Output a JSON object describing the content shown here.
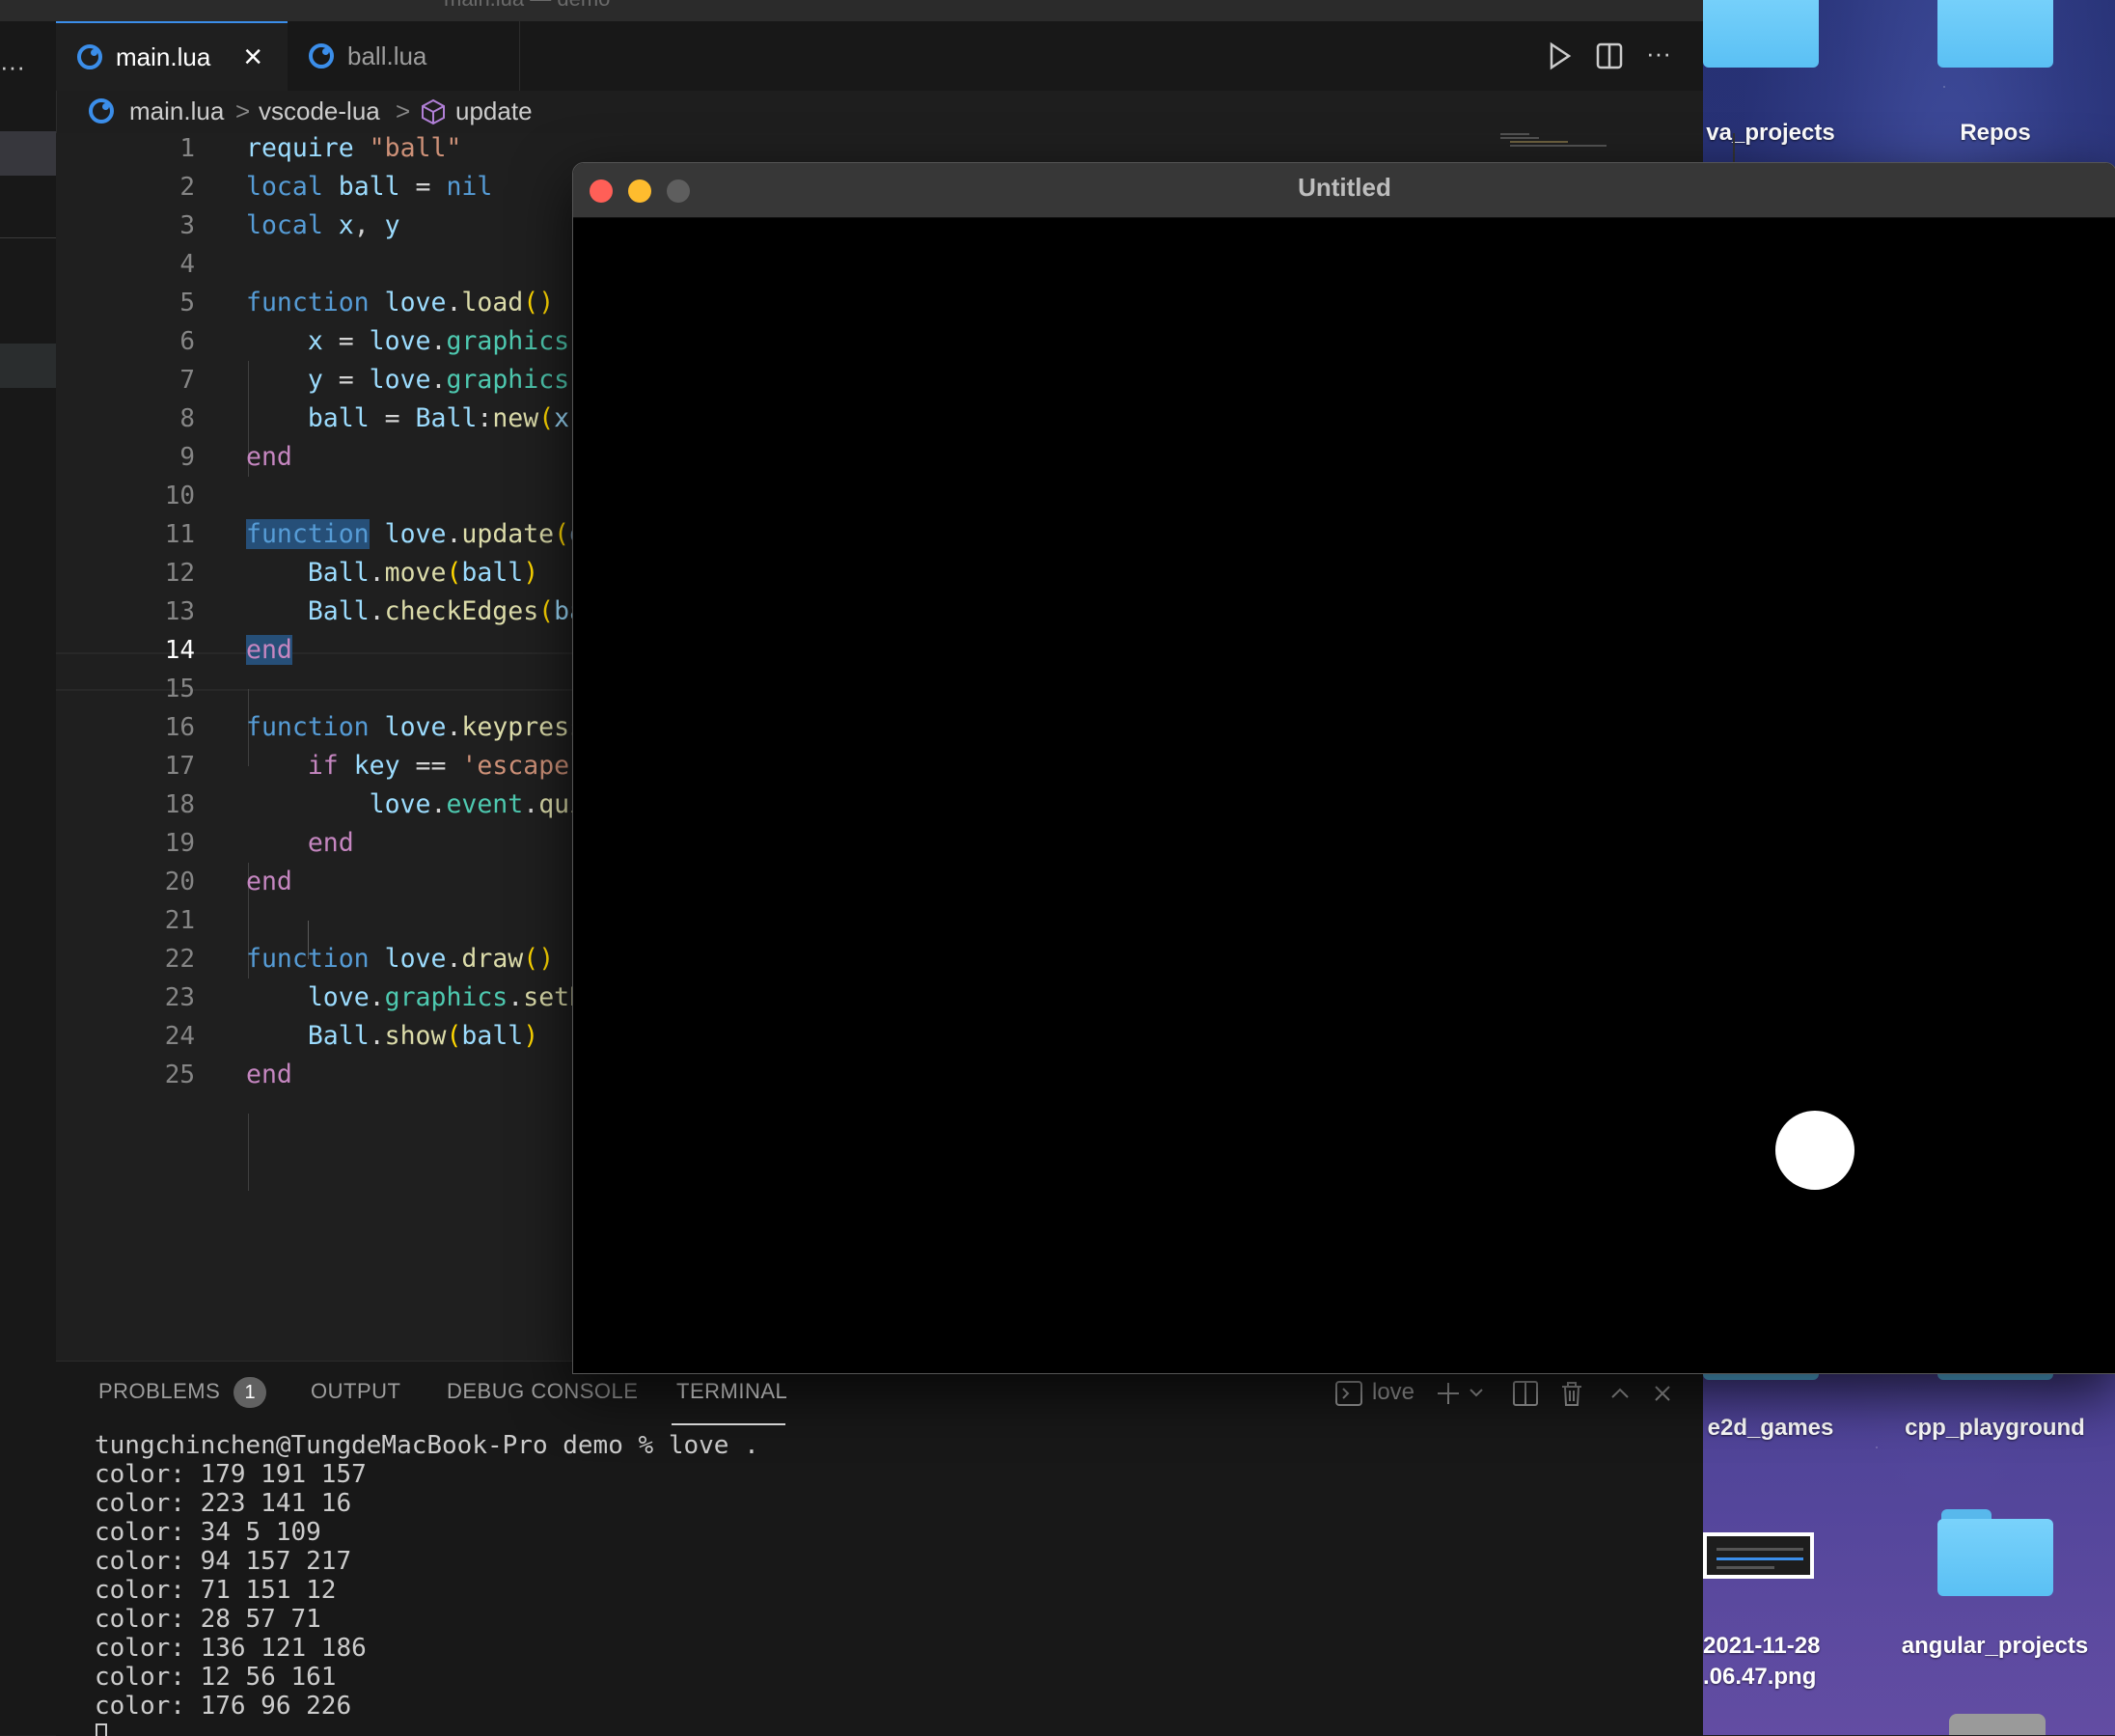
{
  "window_title_partial": "main.lua — demo",
  "tabs": [
    {
      "label": "main.lua",
      "active": true,
      "close": "×"
    },
    {
      "label": "ball.lua",
      "active": false
    }
  ],
  "toolbar": {
    "run_icon": "play-icon",
    "split_icon": "split-editor-icon",
    "more": "···"
  },
  "activity_more": "···",
  "breadcrumb": {
    "file": "main.lua",
    "sep1": ">",
    "folder": "vscode-lua",
    "sep2": ">",
    "symbol": "update"
  },
  "editor": {
    "current_line": 14,
    "line_numbers": [
      "1",
      "2",
      "3",
      "4",
      "5",
      "6",
      "7",
      "8",
      "9",
      "10",
      "11",
      "12",
      "13",
      "14",
      "15",
      "16",
      "17",
      "18",
      "19",
      "20",
      "21",
      "22",
      "23",
      "24",
      "25"
    ]
  },
  "panel": {
    "tabs": [
      "PROBLEMS",
      "OUTPUT",
      "DEBUG CONSOLE",
      "TERMINAL"
    ],
    "problems_badge": "1",
    "active_tab": "TERMINAL",
    "terminal_name": "love",
    "terminal_lines": [
      "tungchinchen@TungdeMacBook-Pro demo % love .",
      "color: 179 191 157",
      "color: 223 141 16",
      "color: 34 5 109",
      "color: 94 157 217",
      "color: 71 151 12",
      "color: 28 57 71",
      "color: 136 121 186",
      "color: 12 56 161",
      "color: 176 96 226"
    ]
  },
  "love_window": {
    "title": "Untitled"
  },
  "desktop": {
    "items": [
      {
        "label": "va_projects"
      },
      {
        "label": "Repos"
      },
      {
        "label": "e2d_games"
      },
      {
        "label": "cpp_playground"
      },
      {
        "label": "2021-11-28"
      },
      {
        "label": ".06.47.png"
      },
      {
        "label": "angular_projects"
      }
    ]
  },
  "colors": {
    "accent": "#3b8eea",
    "close": "#ff5f57",
    "minimize": "#febc2e",
    "zoom": "#5e5e5e",
    "folder": "#6ccaf8"
  }
}
